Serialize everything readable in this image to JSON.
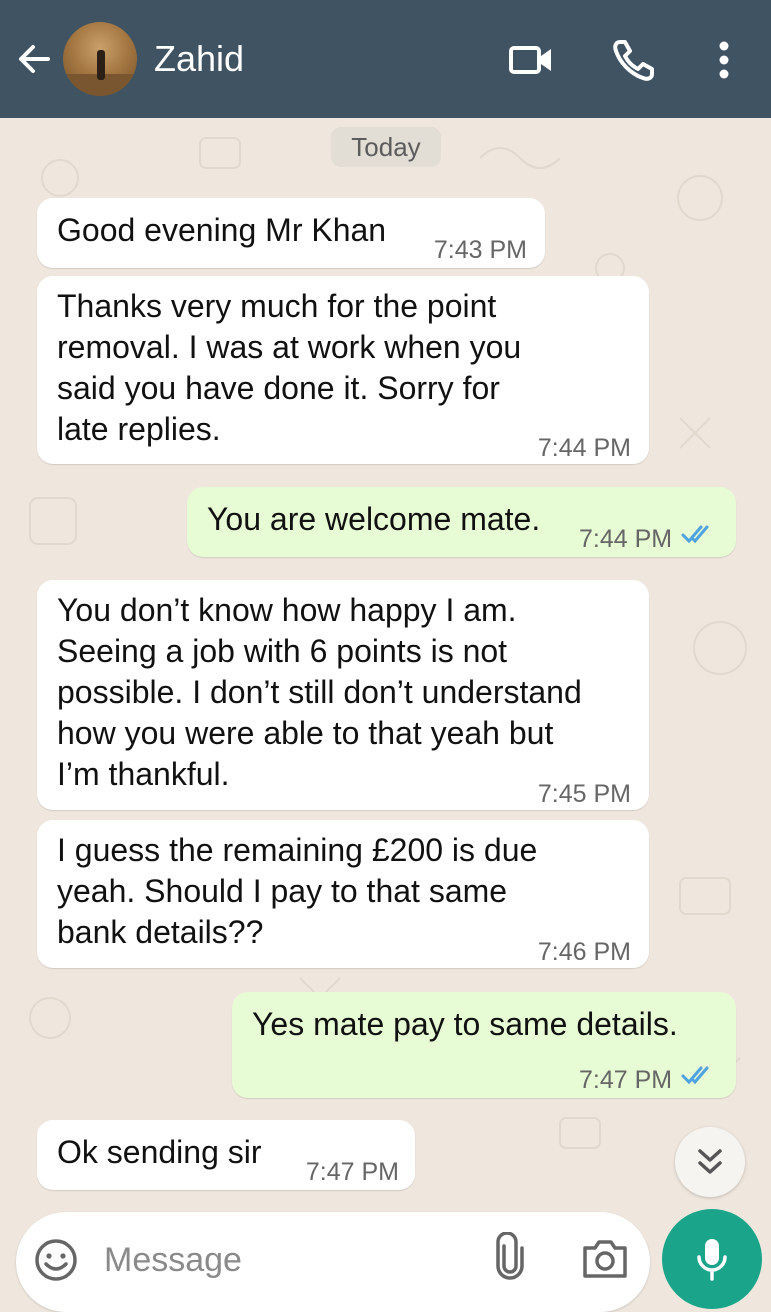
{
  "header": {
    "contact_name": "Zahid",
    "back_icon": "arrow-left-icon",
    "avatar_icon": "contact-avatar",
    "video_icon": "video-call-icon",
    "call_icon": "phone-icon",
    "menu_icon": "more-vertical-icon",
    "color": "#3f5362"
  },
  "chat": {
    "date_chip": "Today",
    "messages": [
      {
        "direction": "incoming",
        "lines": [
          "Good evening Mr Khan"
        ],
        "time": "7:43 PM"
      },
      {
        "direction": "incoming",
        "lines": [
          "Thanks very much for the point",
          "removal. I was at work when you",
          "said you have done it. Sorry for",
          "late replies."
        ],
        "time": "7:44 PM"
      },
      {
        "direction": "outgoing",
        "lines": [
          "You are welcome mate."
        ],
        "time": "7:44 PM",
        "status": "read"
      },
      {
        "direction": "incoming",
        "lines": [
          "You don’t know how happy I am.",
          "Seeing a job with 6 points is not",
          "possible. I don’t still don’t understand",
          "how you were able to that yeah but",
          "I’m thankful."
        ],
        "time": "7:45 PM"
      },
      {
        "direction": "incoming",
        "lines": [
          "I guess the remaining £200 is due",
          "yeah. Should I pay to that same",
          "bank details??"
        ],
        "time": "7:46 PM"
      },
      {
        "direction": "outgoing",
        "lines": [
          "Yes mate pay to same details."
        ],
        "time": "7:47 PM",
        "status": "read"
      },
      {
        "direction": "incoming",
        "lines": [
          "Ok sending sir"
        ],
        "time": "7:47 PM"
      }
    ],
    "incoming_bubble_color": "#ffffff",
    "outgoing_bubble_color": "#e7fcd4",
    "read_tick_color": "#4fa3e0"
  },
  "composer": {
    "placeholder": "Message",
    "emoji_icon": "emoji-icon",
    "attach_icon": "paperclip-icon",
    "camera_icon": "camera-icon",
    "mic_icon": "microphone-icon",
    "accent": "#1aa58a"
  },
  "scroll_button_icon": "double-chevron-down-icon"
}
